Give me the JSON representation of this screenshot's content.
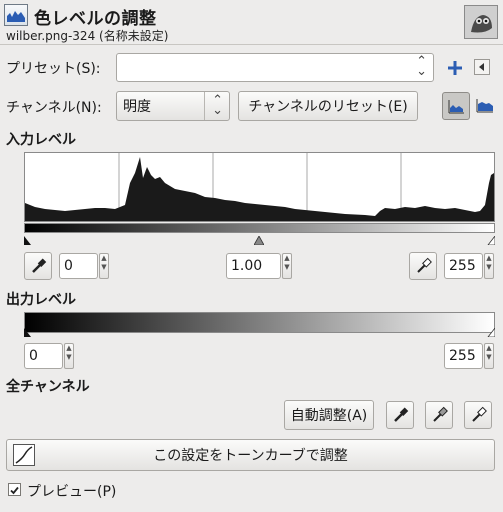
{
  "header": {
    "title": "色レベルの調整",
    "subtitle": "wilber.png-324 (名称未設定)"
  },
  "presets": {
    "label": "プリセット(S):",
    "value": ""
  },
  "channel": {
    "label": "チャンネル(N):",
    "selected": "明度",
    "reset_label": "チャンネルのリセット(E)"
  },
  "input_levels": {
    "title": "入力レベル",
    "low": "0",
    "gamma": "1.00",
    "high": "255"
  },
  "output_levels": {
    "title": "出力レベル",
    "low": "0",
    "high": "255"
  },
  "all_channels": {
    "title": "全チャンネル",
    "auto_label": "自動調整(A)"
  },
  "curve_button_label": "この設定をトーンカーブで調整",
  "preview": {
    "label": "プレビュー(P)",
    "checked": true
  },
  "colors": {
    "accent": "#2b5db3"
  }
}
